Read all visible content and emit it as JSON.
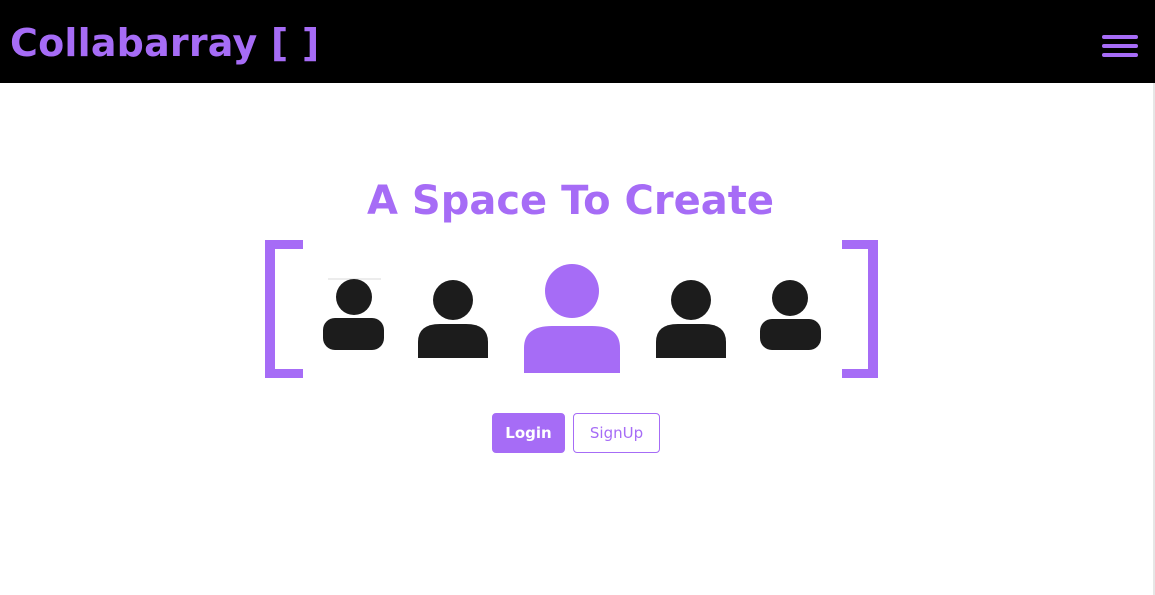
{
  "app": {
    "brand": "Collabarray [ ]",
    "headline": "A Space To Create"
  },
  "navbar": {
    "menu_icon": "hamburger-menu-icon"
  },
  "hero": {
    "bracket_icons": [
      "left-bracket-icon",
      "right-bracket-icon"
    ],
    "people": [
      {
        "icon": "user-icon",
        "highlighted": false
      },
      {
        "icon": "user-icon",
        "highlighted": false
      },
      {
        "icon": "user-icon",
        "highlighted": true
      },
      {
        "icon": "user-icon",
        "highlighted": false
      },
      {
        "icon": "user-icon",
        "highlighted": false
      }
    ]
  },
  "actions": {
    "login_label": "Login",
    "signup_label": "SignUp"
  },
  "colors": {
    "accent": "#a66cf6",
    "navbar_bg": "#000000",
    "page_bg": "#ffffff",
    "person_default": "#1c1c1c"
  }
}
